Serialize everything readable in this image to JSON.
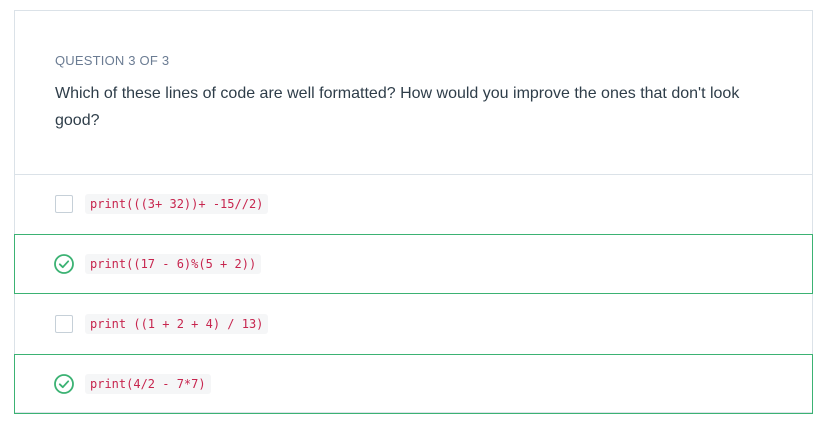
{
  "quiz": {
    "question_counter": "QUESTION 3 OF 3",
    "question_text": "Which of these lines of code are well formatted? How would you improve the ones that don't look good?",
    "options": [
      {
        "code": "print(((3+ 32))+ -15//2)",
        "checked": false
      },
      {
        "code": "print((17 - 6)%(5 + 2))",
        "checked": true
      },
      {
        "code": "print ((1 + 2 + 4) / 13)",
        "checked": false
      },
      {
        "code": "print(4/2 - 7*7)",
        "checked": true
      }
    ]
  },
  "colors": {
    "correct_green": "#3bb273",
    "code_red": "#c7254e",
    "border_gray": "#dbe2e8"
  },
  "icons": {
    "checked": "check-circle-icon",
    "unchecked": "empty-checkbox"
  }
}
